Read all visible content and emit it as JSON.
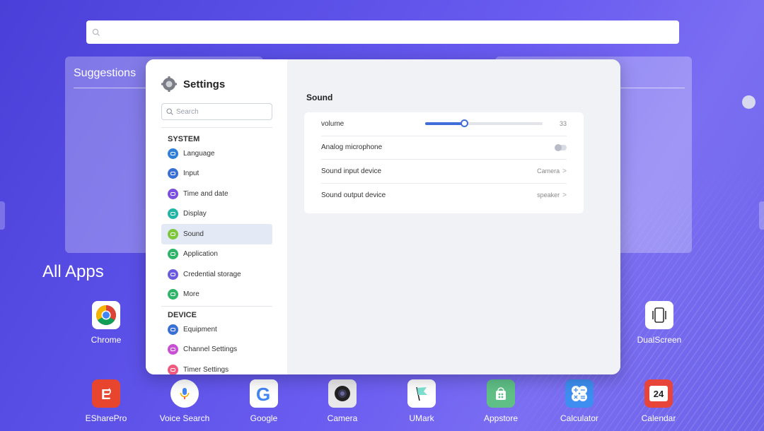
{
  "search": {
    "placeholder": ""
  },
  "home": {
    "suggestions_label": "Suggestions",
    "all_apps_label": "All Apps"
  },
  "apps_row1": [
    {
      "label": "Chrome",
      "icon": "chrome-icon"
    },
    {
      "label": "DualScreen",
      "icon": "dualscreen-icon"
    }
  ],
  "dock": [
    {
      "label": "ESharePro",
      "icon": "esharepro-icon",
      "color": "#e8452e"
    },
    {
      "label": "Voice Search",
      "icon": "microphone-icon",
      "color": "#ffffff"
    },
    {
      "label": "Google",
      "icon": "google-icon",
      "color": "#ffffff"
    },
    {
      "label": "Camera",
      "icon": "camera-icon",
      "color": "#e8e8ea"
    },
    {
      "label": "UMark",
      "icon": "flag-icon",
      "color": "#ffffff"
    },
    {
      "label": "Appstore",
      "icon": "bag-icon",
      "color": "#5fbf86"
    },
    {
      "label": "Calculator",
      "icon": "calculator-icon",
      "color": "#3d8ef0"
    },
    {
      "label": "Calendar",
      "icon": "calendar-icon",
      "color": "#e8453a",
      "badge": "24"
    }
  ],
  "settings": {
    "title": "Settings",
    "search_placeholder": "Search",
    "system_group": "SYSTEM",
    "system_items": [
      {
        "label": "Language",
        "icon": "globe-icon",
        "color": "#2f80d8"
      },
      {
        "label": "Input",
        "icon": "keyboard-icon",
        "color": "#3a6fd6"
      },
      {
        "label": "Time and date",
        "icon": "clock-icon",
        "color": "#7b4fe0"
      },
      {
        "label": "Display",
        "icon": "eye-icon",
        "color": "#20b5a6"
      },
      {
        "label": "Sound",
        "icon": "speaker-icon",
        "color": "#7dc83a"
      },
      {
        "label": "Application",
        "icon": "grid-icon",
        "color": "#2fb56a"
      },
      {
        "label": "Credential storage",
        "icon": "certificate-icon",
        "color": "#6a5ae0"
      },
      {
        "label": "More",
        "icon": "menu-icon",
        "color": "#2fb56a"
      }
    ],
    "device_group": "DEVICE",
    "device_items": [
      {
        "label": "Equipment",
        "icon": "device-icon",
        "color": "#3a6fd6"
      },
      {
        "label": "Channel Settings",
        "icon": "monitor-icon",
        "color": "#c84fd6"
      },
      {
        "label": "Timer Settings",
        "icon": "timer-icon",
        "color": "#f05a7e"
      }
    ],
    "active_item": "Sound",
    "sound": {
      "title": "Sound",
      "volume_label": "volume",
      "volume_value": "33",
      "volume_level": 0.33,
      "analog_mic_label": "Analog microphone",
      "analog_mic_on": false,
      "input_label": "Sound input device",
      "input_value": "Camera",
      "output_label": "Sound output device",
      "output_value": "speaker"
    }
  }
}
